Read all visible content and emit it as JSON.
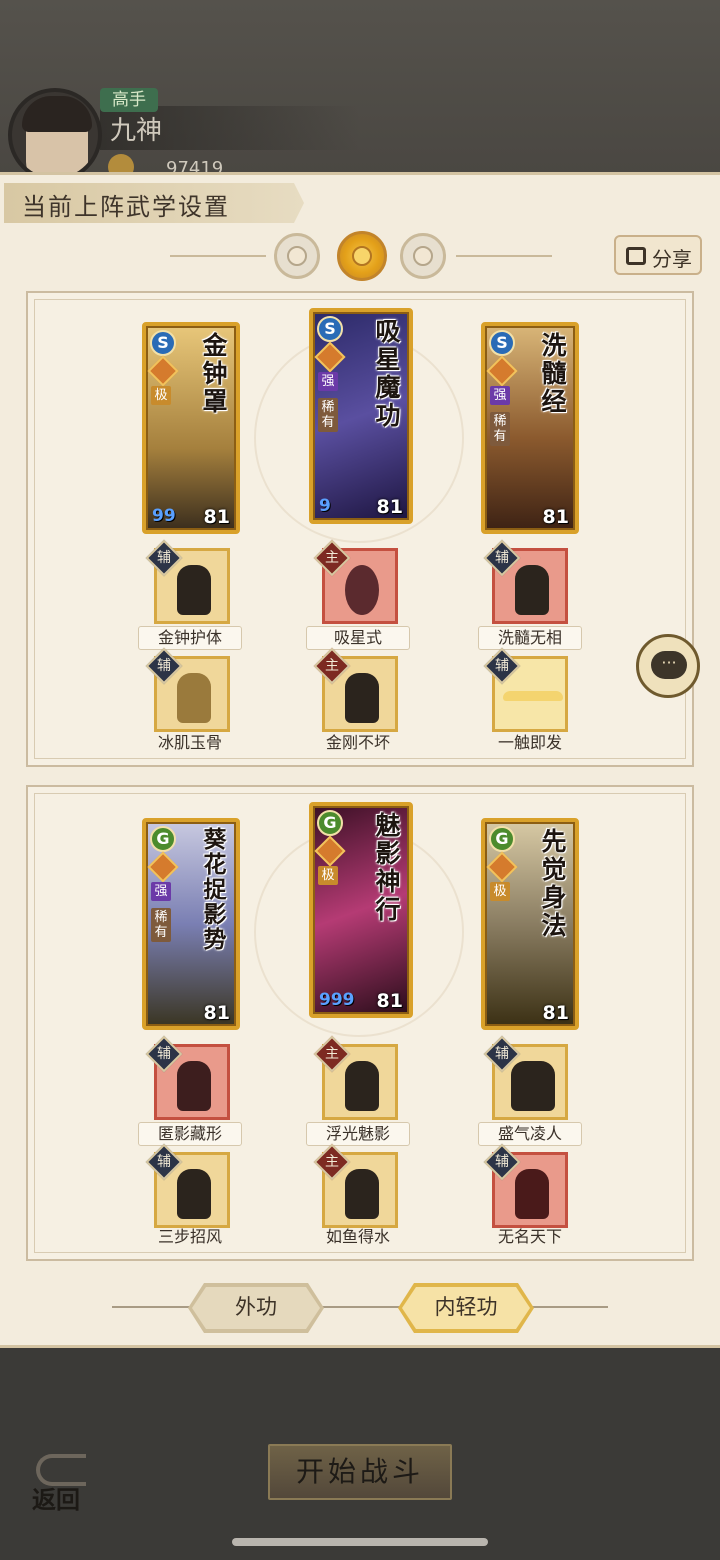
{
  "header": {
    "rank": "高手",
    "player_name": "九神",
    "coins": "97419"
  },
  "panel": {
    "title": "当前上阵武学设置",
    "share_label": "分享"
  },
  "top_group": {
    "cards": [
      {
        "title": "金钟罩",
        "type_icon": "S",
        "badges": [
          "极"
        ],
        "level": "81",
        "drops": "99"
      },
      {
        "title": "吸星魔功",
        "type_icon": "S",
        "badges": [
          "强",
          "稀有"
        ],
        "level": "81",
        "drops": "9"
      },
      {
        "title": "洗髓经",
        "type_icon": "S",
        "badges": [
          "强",
          "稀有"
        ],
        "level": "81",
        "drops": ""
      }
    ],
    "skills_row1": [
      {
        "label": "金钟护体",
        "tag": "辅",
        "style": "gold"
      },
      {
        "label": "吸星式",
        "tag": "主",
        "style": "red"
      },
      {
        "label": "洗髓无相",
        "tag": "辅",
        "style": "red"
      }
    ],
    "skills_row2": [
      {
        "label": "冰肌玉骨",
        "tag": "辅",
        "style": "gold"
      },
      {
        "label": "金刚不坏",
        "tag": "主",
        "style": "gold"
      },
      {
        "label": "一触即发",
        "tag": "辅",
        "style": "gold"
      }
    ]
  },
  "bottom_group": {
    "cards": [
      {
        "title": "葵花捉影势",
        "type_icon": "G",
        "badges": [
          "强",
          "稀有"
        ],
        "level": "81",
        "drops": ""
      },
      {
        "title": "魅影神行",
        "type_icon": "G",
        "badges": [
          "极"
        ],
        "level": "81",
        "drops": "999"
      },
      {
        "title": "先觉身法",
        "type_icon": "G",
        "badges": [
          "极"
        ],
        "level": "81",
        "drops": ""
      }
    ],
    "skills_row1": [
      {
        "label": "匿影藏形",
        "tag": "辅",
        "style": "red"
      },
      {
        "label": "浮光魅影",
        "tag": "主",
        "style": "gold"
      },
      {
        "label": "盛气凌人",
        "tag": "辅",
        "style": "gold"
      }
    ],
    "skills_row2": [
      {
        "label": "三步招风",
        "tag": "辅",
        "style": "gold"
      },
      {
        "label": "如鱼得水",
        "tag": "主",
        "style": "gold"
      },
      {
        "label": "无名天下",
        "tag": "辅",
        "style": "red"
      }
    ]
  },
  "tabs": [
    {
      "label": "外功",
      "active": false
    },
    {
      "label": "内轻功",
      "active": true
    }
  ],
  "chat_label": "···",
  "footer": {
    "start_label": "开始战斗",
    "back_label": "返回"
  },
  "colors": {
    "panel_bg": "#f3ecdd",
    "card_border": "#d9a12a",
    "active_mode": "#e3a019"
  }
}
